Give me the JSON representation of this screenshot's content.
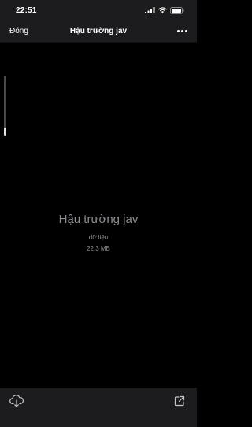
{
  "status_bar": {
    "time": "22:51",
    "icons": [
      "signal-icon",
      "wifi-icon",
      "battery-icon"
    ]
  },
  "nav_bar": {
    "close_label": "Đóng",
    "title": "Hậu trường jav",
    "more_icon": "more-horizontal-icon"
  },
  "preview": {
    "file_name": "Hậu trường jav",
    "file_type": "dữ liệu",
    "file_size": "22,3 MB"
  },
  "toolbar": {
    "left_icon": "cloud-download-icon",
    "right_icon": "open-external-icon"
  },
  "colors": {
    "background": "#000000",
    "bar_background": "#1c1c1e",
    "secondary_text": "#8e8e93",
    "primary_text": "#ffffff"
  }
}
